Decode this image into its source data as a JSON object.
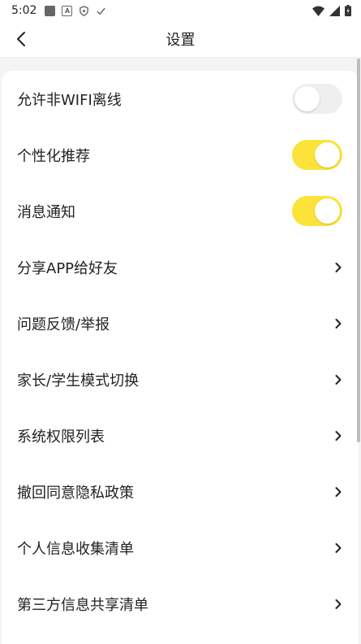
{
  "status_bar": {
    "time": "5:02"
  },
  "header": {
    "title": "设置"
  },
  "toggles": [
    {
      "label": "允许非WIFI离线",
      "state": "off"
    },
    {
      "label": "个性化推荐",
      "state": "on"
    },
    {
      "label": "消息通知",
      "state": "on"
    }
  ],
  "links": [
    {
      "label": "分享APP给好友"
    },
    {
      "label": "问题反馈/举报"
    },
    {
      "label": "家长/学生模式切换"
    },
    {
      "label": "系统权限列表"
    },
    {
      "label": "撤回同意隐私政策"
    },
    {
      "label": "个人信息收集清单"
    },
    {
      "label": "第三方信息共享清单"
    }
  ],
  "colors": {
    "toggle_on": "#fbe33a",
    "toggle_off": "#efefef"
  }
}
